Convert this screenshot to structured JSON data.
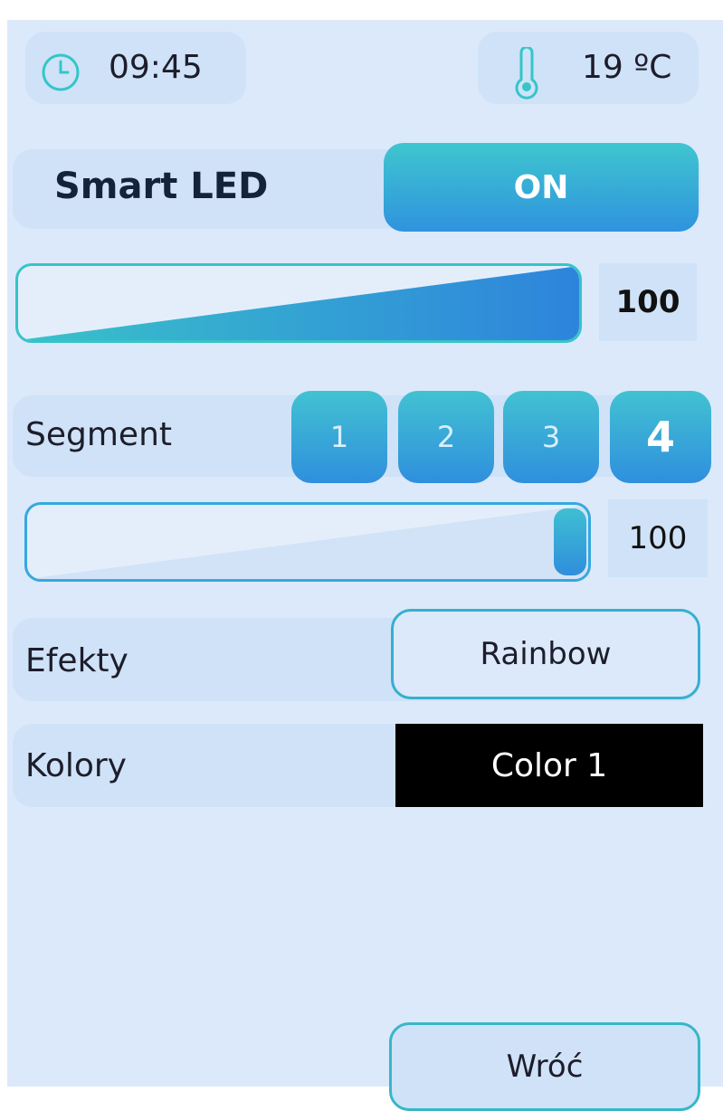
{
  "header": {
    "time": "09:45",
    "temperature": "19 ºC",
    "clock_icon": "clock-icon",
    "thermometer_icon": "thermometer-icon"
  },
  "led": {
    "title": "Smart LED",
    "power_label": "ON"
  },
  "brightness": {
    "value": "100",
    "level": 1.0
  },
  "segment": {
    "label": "Segment",
    "buttons": [
      "1",
      "2",
      "3",
      "4"
    ],
    "active": "4",
    "value": "100",
    "level": 1.0
  },
  "effects": {
    "label": "Efekty",
    "selected": "Rainbow"
  },
  "colors": {
    "label": "Kolory",
    "selected": "Color 1"
  },
  "footer": {
    "back_label": "Wróć"
  },
  "colors_theme": {
    "accent_top": "#3fc6cf",
    "accent_bottom": "#2f93de",
    "background": "#dce9fa",
    "panel": "#cfe2f8"
  }
}
